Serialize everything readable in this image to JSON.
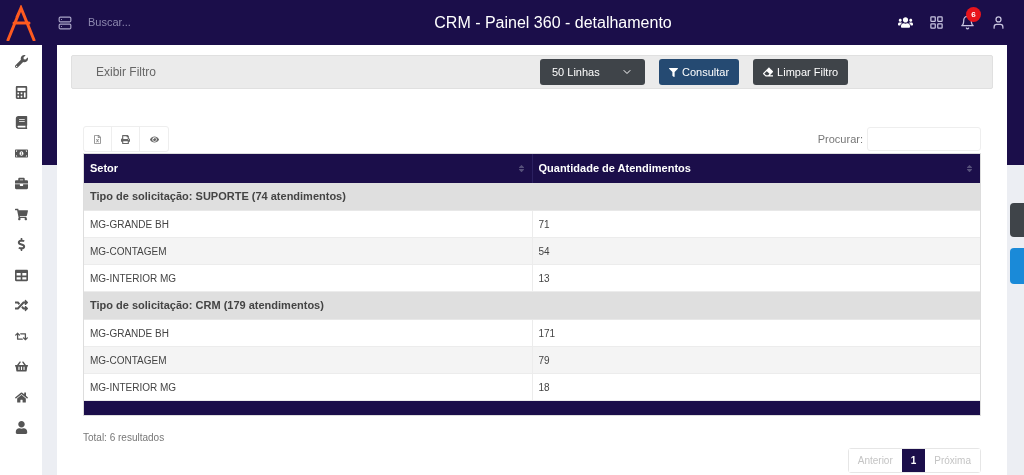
{
  "header": {
    "title": "CRM - Painel 360 - detalhamento",
    "search": {
      "placeholder": "Buscar..."
    },
    "notifications": {
      "count": "6"
    }
  },
  "filter_bar": {
    "toggle": "Exibir Filtro",
    "rows_select": "50 Linhas",
    "query_button": "Consultar",
    "clear_button": "Limpar Filtro"
  },
  "search": {
    "label": "Procurar:"
  },
  "table": {
    "columns": [
      "Setor",
      "Quantidade de Atendimentos"
    ],
    "rows": [
      {
        "kind": "group",
        "label": "Tipo de solicitação: SUPORTE (74 atendimentos)"
      },
      {
        "kind": "row",
        "cells": [
          "MG-GRANDE BH",
          "71"
        ]
      },
      {
        "kind": "row",
        "cells": [
          "MG-CONTAGEM",
          "54"
        ]
      },
      {
        "kind": "row",
        "cells": [
          "MG-INTERIOR MG",
          "13"
        ]
      },
      {
        "kind": "group",
        "label": "Tipo de solicitação: CRM (179 atendimentos)"
      },
      {
        "kind": "row",
        "cells": [
          "MG-GRANDE BH",
          "171"
        ]
      },
      {
        "kind": "row",
        "cells": [
          "MG-CONTAGEM",
          "79"
        ]
      },
      {
        "kind": "row",
        "cells": [
          "MG-INTERIOR MG",
          "18"
        ]
      }
    ]
  },
  "total": "Total: 6 resultados",
  "pagination": [
    {
      "label": "Anterior",
      "selected": false,
      "disabled": true
    },
    {
      "label": "1",
      "selected": true,
      "disabled": false
    },
    {
      "label": "Próxima",
      "selected": false,
      "disabled": true
    }
  ]
}
